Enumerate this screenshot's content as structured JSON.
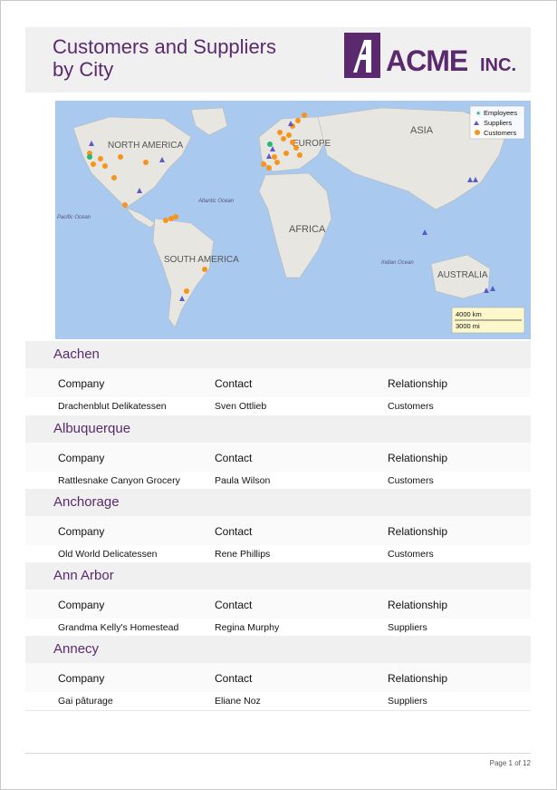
{
  "report": {
    "title": "Customers and Suppliers\nby City",
    "logo_text": "ACME",
    "logo_suffix": "INC.",
    "brand_color": "#5b2a6e"
  },
  "map": {
    "labels": [
      "NORTH AMERICA",
      "EUROPE",
      "ASIA",
      "AFRICA",
      "SOUTH AMERICA",
      "AUSTRALIA",
      "Atlantic Ocean",
      "Indian Ocean",
      "Pacific Ocean"
    ],
    "legend": [
      {
        "label": "Employees",
        "icon": "star-icon",
        "color": "#2bb673"
      },
      {
        "label": "Suppliers",
        "icon": "triangle-icon",
        "color": "#5a5acb"
      },
      {
        "label": "Customers",
        "icon": "circle-icon",
        "color": "#f7941d"
      }
    ],
    "scale": {
      "km": "4000 km",
      "mi": "3000 mi"
    }
  },
  "columns": {
    "company": "Company",
    "contact": "Contact",
    "relationship": "Relationship"
  },
  "groups": [
    {
      "city": "Aachen",
      "company": "Drachenblut Delikatessen",
      "contact": "Sven Ottlieb",
      "relationship": "Customers"
    },
    {
      "city": "Albuquerque",
      "company": "Rattlesnake Canyon Grocery",
      "contact": "Paula Wilson",
      "relationship": "Customers"
    },
    {
      "city": "Anchorage",
      "company": "Old World Delicatessen",
      "contact": "Rene Phillips",
      "relationship": "Customers"
    },
    {
      "city": "Ann Arbor",
      "company": "Grandma Kelly's Homestead",
      "contact": "Regina Murphy",
      "relationship": "Suppliers"
    },
    {
      "city": "Annecy",
      "company": "Gai pâturage",
      "contact": "Eliane Noz",
      "relationship": "Suppliers"
    }
  ],
  "footer": {
    "page": "Page 1 of 12"
  }
}
